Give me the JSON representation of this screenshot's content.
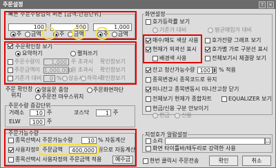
{
  "window": {
    "title": "주문설정",
    "close_glyph": "×",
    "help_glyph": "?"
  },
  "quick": {
    "legend": "빠른 주문수량입력 버튼 [금액:만원단위]",
    "values": [
      "100",
      "500",
      "1,000"
    ],
    "opt_qty": "주",
    "opt_amt": "금액"
  },
  "confirm": {
    "legend": "주문확인창 보기",
    "summary": "요약하기",
    "expand": "펼쳐쓰기",
    "row1_label": "주문수량이",
    "row1_val": "1,000",
    "row1_unit": "주 초과시",
    "row1_tail": "확인창보기",
    "row2_label": "주문금액이",
    "row2_val": "1,000,000",
    "row2_unit": "원 초과시",
    "row2_tail": "확인창보기",
    "row3_label": "기준가 대비",
    "row3_val": "0",
    "row3_pct": "%",
    "row3_up": "상승시",
    "row3_dn": "하락시",
    "row3_tail": "확인창보기"
  },
  "confirm_pos": {
    "label1": "주문 확인창",
    "label2": "위치",
    "o1": "영웅문 중앙",
    "o2": "주문화면하단",
    "o3": "주문전 마우스위치"
  },
  "cancel": {
    "legend": "주문수량 증감단위",
    "l1": "거래소",
    "v1": "10",
    "u1": "주",
    "l2": "코스닥",
    "v2": "1",
    "u2": "주",
    "l3": "ELW",
    "v3": "100",
    "u3": "주"
  },
  "avail": {
    "legend": "주문가능수량",
    "r1_a": "종목선택시 주문가능수량",
    "r1_val": "10",
    "r1_b": "% 자동계산",
    "r2_a": "사용자정의 주문금액",
    "r2_val": "400,000",
    "r2_b": "원으로 자동계산",
    "r3": "종목선택시 사용자정의 주문금액 적용",
    "r3_btn": "예수금"
  },
  "screen": {
    "legend": "화면설정",
    "hoga_title": "호가등락률 보기",
    "hoga_opt1": "기준가 대비",
    "hoga_opt2": "평균매입가 대비",
    "i1a": "매수/매도 색상 사용",
    "i1b": "호가잔량 그래프 보기",
    "i2a": "현재가 외곽선 표시",
    "i2b": "호가별 가로 구분선 표시",
    "i3a": "배경색 사용",
    "i3b": "전체보기시 체결량 보기",
    "i4_lbl": "잔고 청산가능수량",
    "i4_val": "100",
    "i4_unit": "% 적용",
    "i5": "종목변경시 종목코드로 유지",
    "i6": "미니잔고 종목변동시 미니잔고창 닫기",
    "i7a": "전체보기 현재가 종합차트",
    "i7b": "EQUALIZER 보기",
    "i8": "현금/신용 구분 안보이기",
    "i8_o1": "현금",
    "i8_o2": "신용"
  },
  "alarm": {
    "legend": "지정호가 알람설정",
    "sound": "소리",
    "popup": "화면 타이틀바/태두리로 강력한 사용"
  },
  "footer": {
    "first_btn": "한번 클릭시 주문전송",
    "ok": "확인",
    "cancel": "취소"
  },
  "colors": {
    "highlight_red": "#e00000",
    "highlight_yellow": "#f4e04a"
  }
}
